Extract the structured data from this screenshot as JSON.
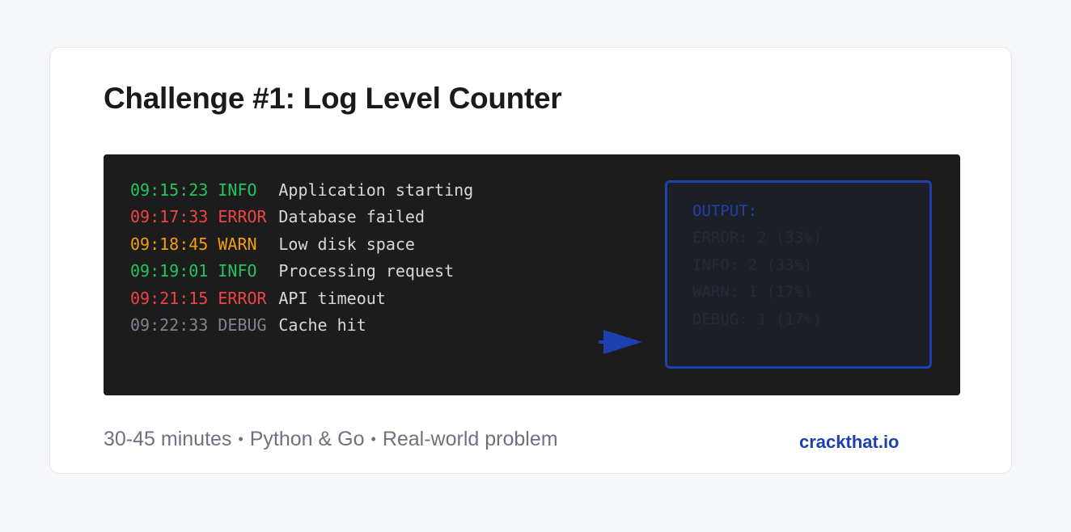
{
  "challenge": {
    "title": "Challenge #1: Log Level Counter"
  },
  "log": {
    "lines": [
      {
        "time": "09:15:23",
        "level": "INFO",
        "message": "Application starting"
      },
      {
        "time": "09:17:33",
        "level": "ERROR",
        "message": "Database failed"
      },
      {
        "time": "09:18:45",
        "level": "WARN",
        "message": "Low disk space"
      },
      {
        "time": "09:19:01",
        "level": "INFO",
        "message": "Processing request"
      },
      {
        "time": "09:21:15",
        "level": "ERROR",
        "message": "API timeout"
      },
      {
        "time": "09:22:33",
        "level": "DEBUG",
        "message": "Cache hit"
      }
    ]
  },
  "output": {
    "title": "OUTPUT:",
    "lines": [
      "ERROR: 2 (33%)",
      "INFO: 2 (33%)",
      "WARN: 1 (17%)",
      "DEBUG: 1 (17%)"
    ]
  },
  "footer": {
    "duration": "30-45 minutes",
    "languages": "Python & Go",
    "type": "Real-world problem",
    "separator": "•",
    "link": "crackthat.io"
  },
  "colors": {
    "info": "#22c55e",
    "error": "#ef4444",
    "warn": "#f59e0b",
    "debug": "#7c8593",
    "accent": "#1e40af",
    "terminal_bg": "#1c1c1c"
  }
}
